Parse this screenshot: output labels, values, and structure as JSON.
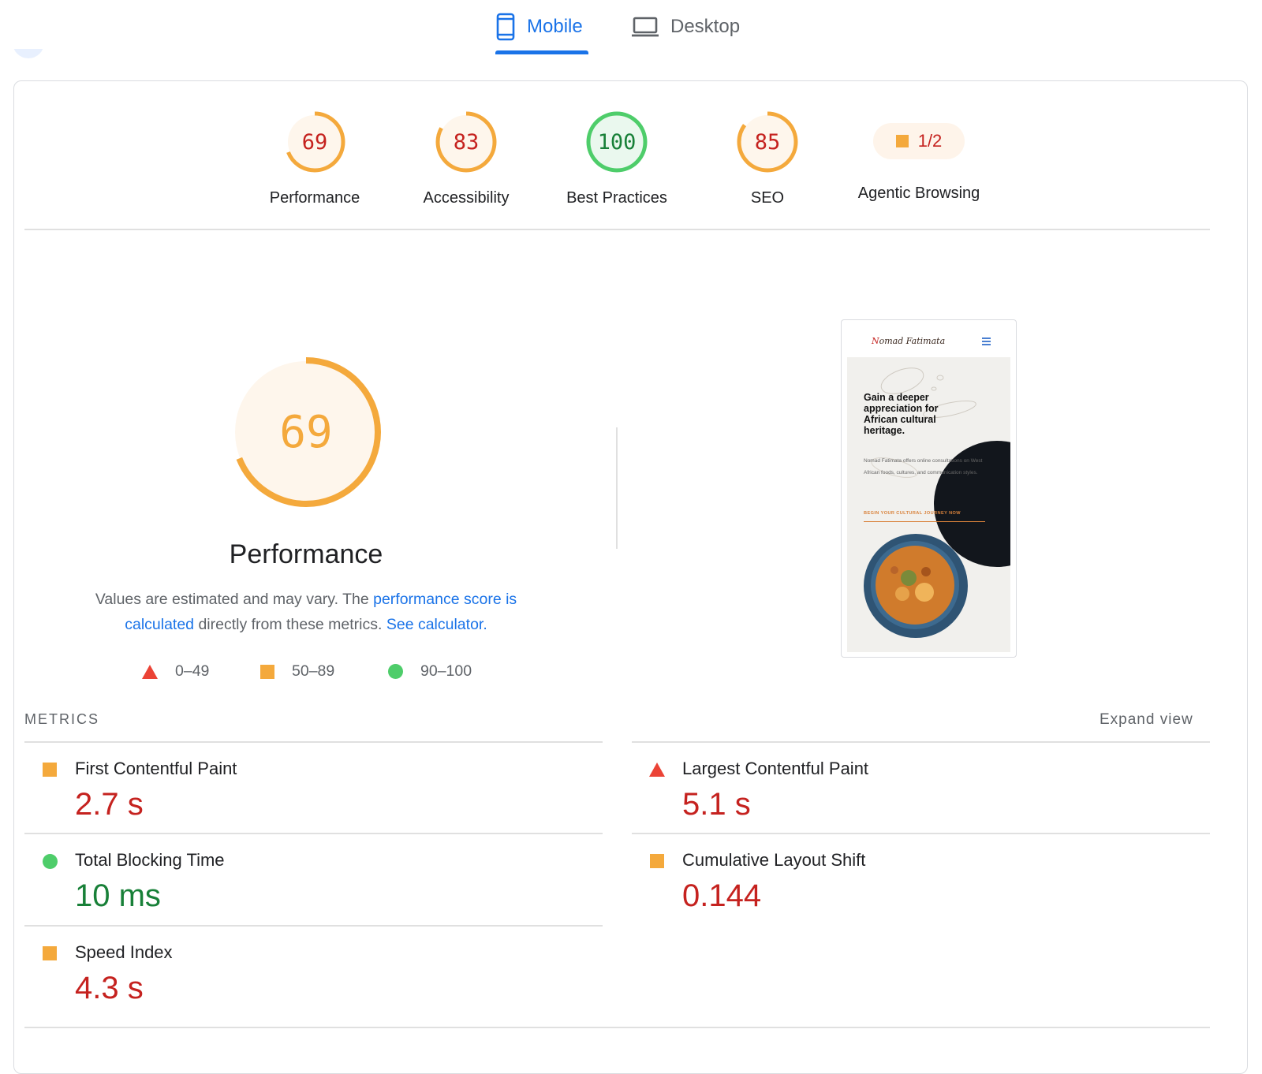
{
  "tabs": [
    {
      "label": "Mobile",
      "icon": "phone-icon",
      "active": true
    },
    {
      "label": "Desktop",
      "icon": "laptop-icon",
      "active": false
    }
  ],
  "colors": {
    "accent": "#1a73e8",
    "fail": "#eb4336",
    "average": "#f4a93c",
    "pass": "#4ecd6a",
    "fail_text": "#c5221f",
    "pass_text": "#188038"
  },
  "summary": {
    "performance": {
      "score": "69",
      "label": "Performance",
      "rating": "average"
    },
    "accessibility": {
      "score": "83",
      "label": "Accessibility",
      "rating": "average"
    },
    "best_practices": {
      "score": "100",
      "label": "Best Practices",
      "rating": "pass"
    },
    "seo": {
      "score": "85",
      "label": "SEO",
      "rating": "average"
    },
    "agentic": {
      "score": "1/2",
      "label": "Agentic Browsing",
      "rating": "average"
    }
  },
  "main": {
    "score": "69",
    "title": "Performance",
    "desc_prefix": "Values are estimated and may vary. The ",
    "desc_link1": "performance score is calculated",
    "desc_middle": " directly from these metrics. ",
    "desc_link2": "See calculator.",
    "legend": [
      {
        "shape": "triangle",
        "range": "0–49"
      },
      {
        "shape": "square",
        "range": "50–89"
      },
      {
        "shape": "circle",
        "range": "90–100"
      }
    ]
  },
  "screenshot": {
    "logo_part1": "N",
    "logo_part2": "omad Fatimata",
    "headline": "Gain a deeper appreciation for African cultural heritage.",
    "body": "Nomad Fatimata offers online consultations on West African foods, cultures, and communication styles.",
    "cta": "BEGIN YOUR CULTURAL JOURNEY NOW"
  },
  "metrics": {
    "heading": "METRICS",
    "expand": "Expand view",
    "fcp": {
      "label": "First Contentful Paint",
      "value": "2.7 s",
      "rating": "average"
    },
    "lcp": {
      "label": "Largest Contentful Paint",
      "value": "5.1 s",
      "rating": "fail"
    },
    "tbt": {
      "label": "Total Blocking Time",
      "value": "10 ms",
      "rating": "pass"
    },
    "cls": {
      "label": "Cumulative Layout Shift",
      "value": "0.144",
      "rating": "average"
    },
    "si": {
      "label": "Speed Index",
      "value": "4.3 s",
      "rating": "average"
    }
  }
}
